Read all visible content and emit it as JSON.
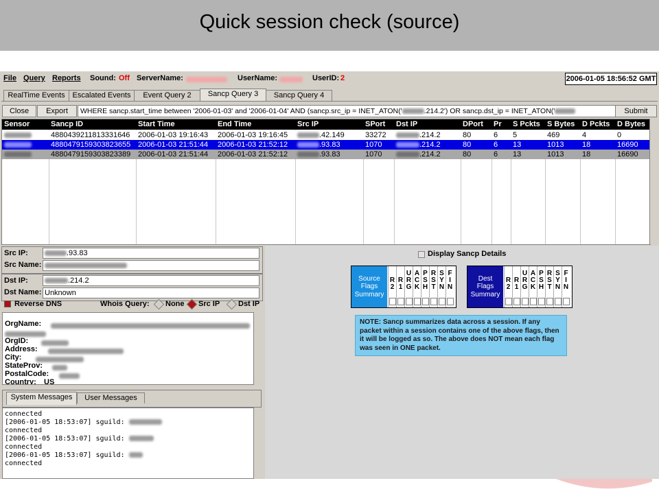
{
  "slide": {
    "title": "Quick session check (source)"
  },
  "menubar": {
    "file": "File",
    "query": "Query",
    "reports": "Reports",
    "sound_label": "Sound:",
    "sound_value": "Off",
    "servername_label": "ServerName:",
    "username_label": "UserName:",
    "userid_label": "UserID:",
    "userid_value": "2",
    "datetime": "2006-01-05 18:56:52 GMT"
  },
  "tabs": [
    {
      "label": "RealTime Events"
    },
    {
      "label": "Escalated Events"
    },
    {
      "label": "Event Query 2"
    },
    {
      "label": "Sancp Query 3"
    },
    {
      "label": "Sancp Query 4"
    }
  ],
  "querybar": {
    "close": "Close",
    "export": "Export",
    "query_text": "WHERE sancp.start_time between '2006-01-03' and '2006-01-04' AND (sancp.src_ip = INET_ATON('",
    "query_mid": ".214.2') OR sancp.dst_ip = INET_ATON('",
    "submit": "Submit"
  },
  "results": {
    "columns": [
      "Sensor",
      "Sancp ID",
      "Start Time",
      "End Time",
      "Src IP",
      "SPort",
      "Dst IP",
      "DPort",
      "Pr",
      "S Pckts",
      "S Bytes",
      "D Pckts",
      "D Bytes"
    ],
    "rows": [
      {
        "sancp_id": "4880439211813331646",
        "start": "2006-01-03 19:16:43",
        "end": "2006-01-03 19:16:45",
        "src_ip": ".42.149",
        "sport": "33272",
        "dst_ip": ".214.2",
        "dport": "80",
        "pr": "6",
        "s_pckts": "5",
        "s_bytes": "469",
        "d_pckts": "4",
        "d_bytes": "0"
      },
      {
        "sancp_id": "4880479159303823655",
        "start": "2006-01-03 21:51:44",
        "end": "2006-01-03 21:52:12",
        "src_ip": ".93.83",
        "sport": "1070",
        "dst_ip": ".214.2",
        "dport": "80",
        "pr": "6",
        "s_pckts": "13",
        "s_bytes": "1013",
        "d_pckts": "18",
        "d_bytes": "16690"
      },
      {
        "sancp_id": "4880479159303823389",
        "start": "2006-01-03 21:51:44",
        "end": "2006-01-03 21:52:12",
        "src_ip": ".93.83",
        "sport": "1070",
        "dst_ip": ".214.2",
        "dport": "80",
        "pr": "6",
        "s_pckts": "13",
        "s_bytes": "1013",
        "d_pckts": "18",
        "d_bytes": "16690"
      }
    ]
  },
  "ipinfo": {
    "src_ip_label": "Src IP:",
    "src_ip_value": ".93.83",
    "src_name_label": "Src Name:",
    "dst_ip_label": "Dst IP:",
    "dst_ip_value": ".214.2",
    "dst_name_label": "Dst Name:",
    "dst_name_value": "Unknown",
    "reverse_dns": "Reverse DNS",
    "whois_label": "Whois Query:",
    "whois_none": "None",
    "whois_src": "Src IP",
    "whois_dst": "Dst IP"
  },
  "whois": {
    "orgname": "OrgName:",
    "orgid": "OrgID:",
    "address": "Address:",
    "city": "City:",
    "stateprov": "StateProv:",
    "postalcode": "PostalCode:",
    "country": "Country:",
    "country_value": "US"
  },
  "message_tabs": {
    "system": "System Messages",
    "user": "User Messages"
  },
  "messages": [
    "connected",
    "[2006-01-05 18:53:07] sguild:",
    "connected",
    "[2006-01-05 18:53:07] sguild:",
    "connected",
    "[2006-01-05 18:53:07] sguild:",
    "connected"
  ],
  "sancp_details": {
    "checkbox_label": "Display Sancp Details",
    "source_head": [
      "Source",
      "Flags",
      "Summary"
    ],
    "dest_head": [
      "Dest",
      "Flags",
      "Summary"
    ],
    "flag_cols": [
      {
        "top": "R",
        "bottom": "2"
      },
      {
        "top": "R",
        "bottom": "1"
      },
      {
        "top": "U\nR",
        "bottom": "G"
      },
      {
        "top": "A\nC",
        "bottom": "K"
      },
      {
        "top": "P\nS",
        "bottom": "H"
      },
      {
        "top": "R\nS",
        "bottom": "T"
      },
      {
        "top": "S\nY",
        "bottom": "N"
      },
      {
        "top": "F\nI",
        "bottom": "N"
      }
    ],
    "note": "NOTE: Sancp summarizes data across a session. If any packet within a session contains one of the above flags, then it will be logged as so. The above does NOT mean each flag was seen in ONE packet."
  },
  "colors": {
    "accent_blue": "#0000e0",
    "flag_blue": "#1a8fe0",
    "flag_dark": "#1010a0",
    "note_bg": "#7ecbf0"
  }
}
